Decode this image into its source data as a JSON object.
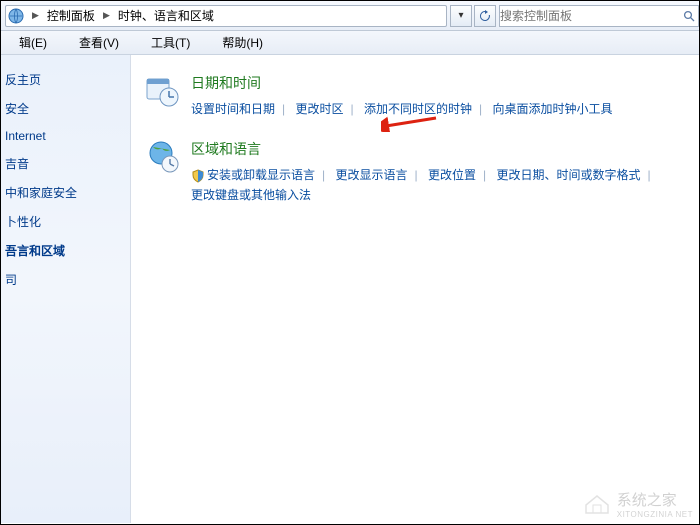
{
  "addressbar": {
    "crumb1": "控制面板",
    "crumb2": "时钟、语言和区域",
    "search_placeholder": "搜索控制面板"
  },
  "menubar": {
    "edit": "辑(E)",
    "view": "查看(V)",
    "tools": "工具(T)",
    "help": "帮助(H)"
  },
  "sidebar": {
    "items": [
      "反主页",
      "安全",
      "Internet",
      "吉音",
      "中和家庭安全",
      "卜性化",
      "吾言和区域",
      "司"
    ]
  },
  "sections": {
    "datetime": {
      "title": "日期和时间",
      "links": [
        "设置时间和日期",
        "更改时区",
        "添加不同时区的时钟",
        "向桌面添加时钟小工具"
      ]
    },
    "region": {
      "title": "区域和语言",
      "links": [
        "安装或卸载显示语言",
        "更改显示语言",
        "更改位置",
        "更改日期、时间或数字格式",
        "更改键盘或其他输入法"
      ]
    }
  },
  "watermark": {
    "text": "系统之家",
    "url": "XITONGZINIA NET"
  }
}
